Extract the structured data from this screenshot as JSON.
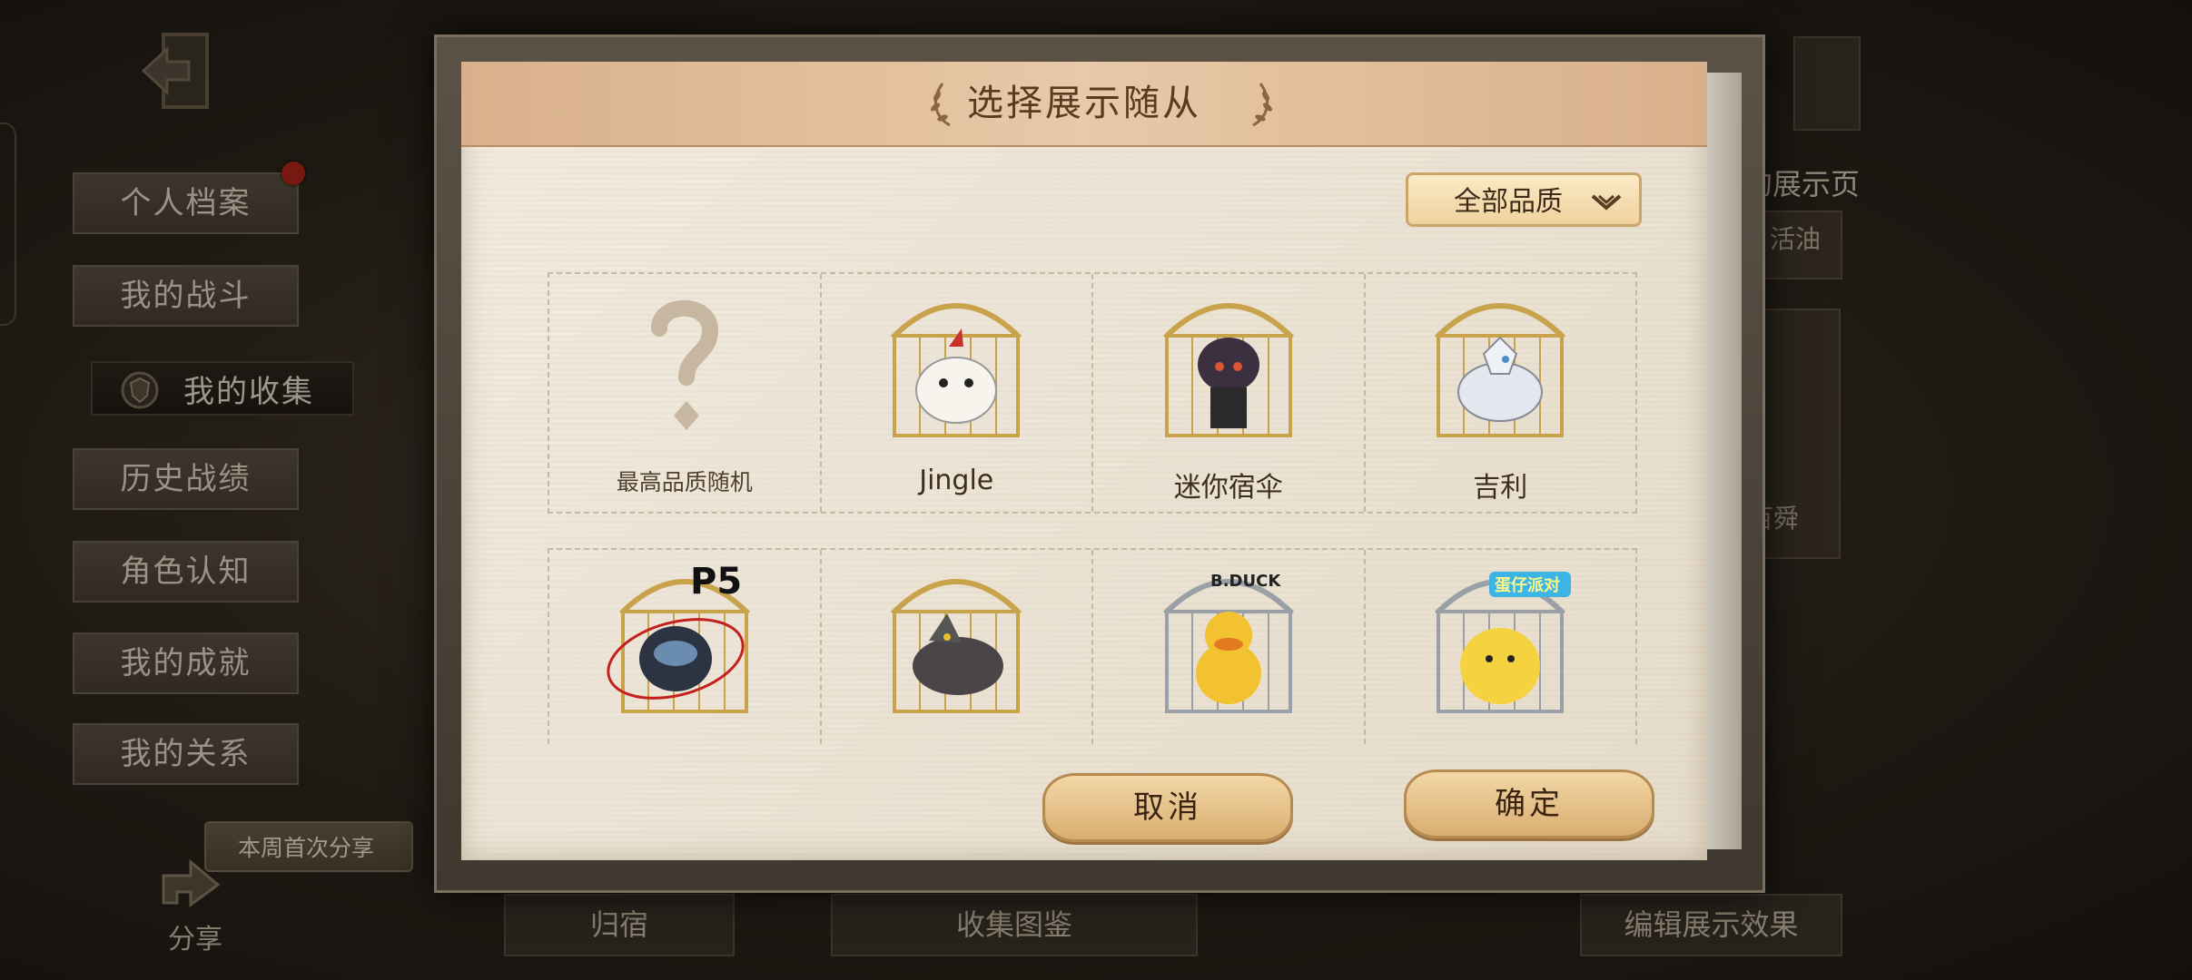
{
  "sidebar": {
    "menu": [
      "个人档案",
      "我的战斗",
      "我的收集",
      "历史战绩",
      "角色认知",
      "我的成就",
      "我的关系"
    ],
    "active_index": 2,
    "share_banner": "本周首次分享",
    "share_label": "分享"
  },
  "background": {
    "right_title": "的展示页",
    "right_tag": "活油",
    "right_frame_text": "百舜",
    "bottom_buttons": [
      "归宿",
      "收集图鉴",
      "编辑展示效果"
    ]
  },
  "dialog": {
    "title": "选择展示随从",
    "quality_filter": "全部品质",
    "items": [
      {
        "label": "最高品质随机",
        "icon": "question-mark-icon"
      },
      {
        "label": "Jingle",
        "icon": "white-dog-pet-icon"
      },
      {
        "label": "迷你宿伞",
        "icon": "umbrella-spirit-pet-icon"
      },
      {
        "label": "吉利",
        "icon": "white-wolf-pet-icon"
      },
      {
        "label": "",
        "icon": "morgana-cat-pet-icon",
        "badge": "P5 PERSONA5"
      },
      {
        "label": "",
        "icon": "grey-wolf-pet-icon"
      },
      {
        "label": "",
        "icon": "yellow-duck-pet-icon",
        "badge": "B.DUCK"
      },
      {
        "label": "",
        "icon": "eggy-pet-icon",
        "badge": "蛋仔派对"
      }
    ],
    "cancel_label": "取消",
    "confirm_label": "确定"
  },
  "colors": {
    "title_bar": "#e1bd98",
    "button": "#e6c28c",
    "paper": "#ede6d8",
    "accent_red": "#b12218"
  }
}
